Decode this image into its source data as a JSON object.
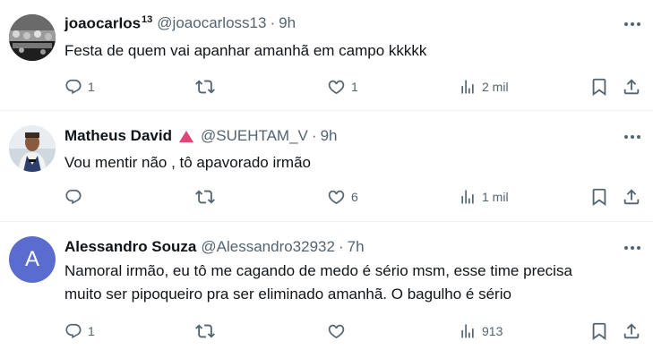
{
  "tweets": [
    {
      "name": "joaocarlos",
      "name_sup": "13",
      "handle": "@joaocarloss13",
      "time": "9h",
      "text": "Festa de quem vai apanhar amanhã em campo kkkkk",
      "replies": "1",
      "retweets": "",
      "likes": "1",
      "views": "2 mil",
      "avatar": "crowd-photo"
    },
    {
      "name": "Matheus David",
      "handle": "@SUEHTAM_V",
      "time": "9h",
      "text": "Vou mentir não , tô apavorado irmão",
      "replies": "",
      "retweets": "",
      "likes": "6",
      "views": "1 mil",
      "avatar": "person-photo",
      "badge": "red-triangle-icon"
    },
    {
      "name": "Alessandro Souza",
      "handle": "@Alessandro32932",
      "time": "7h",
      "text_line1": "Namoral irmão, eu tô me cagando de medo é sério msm, esse time precisa",
      "text_line2": "muito ser pipoqueiro pra ser eliminado amanhã. O bagulho é sério",
      "replies": "1",
      "retweets": "",
      "likes": "",
      "views": "913",
      "avatar_letter": "A",
      "avatar_color": "#5b6ccf"
    }
  ],
  "separator": "·"
}
